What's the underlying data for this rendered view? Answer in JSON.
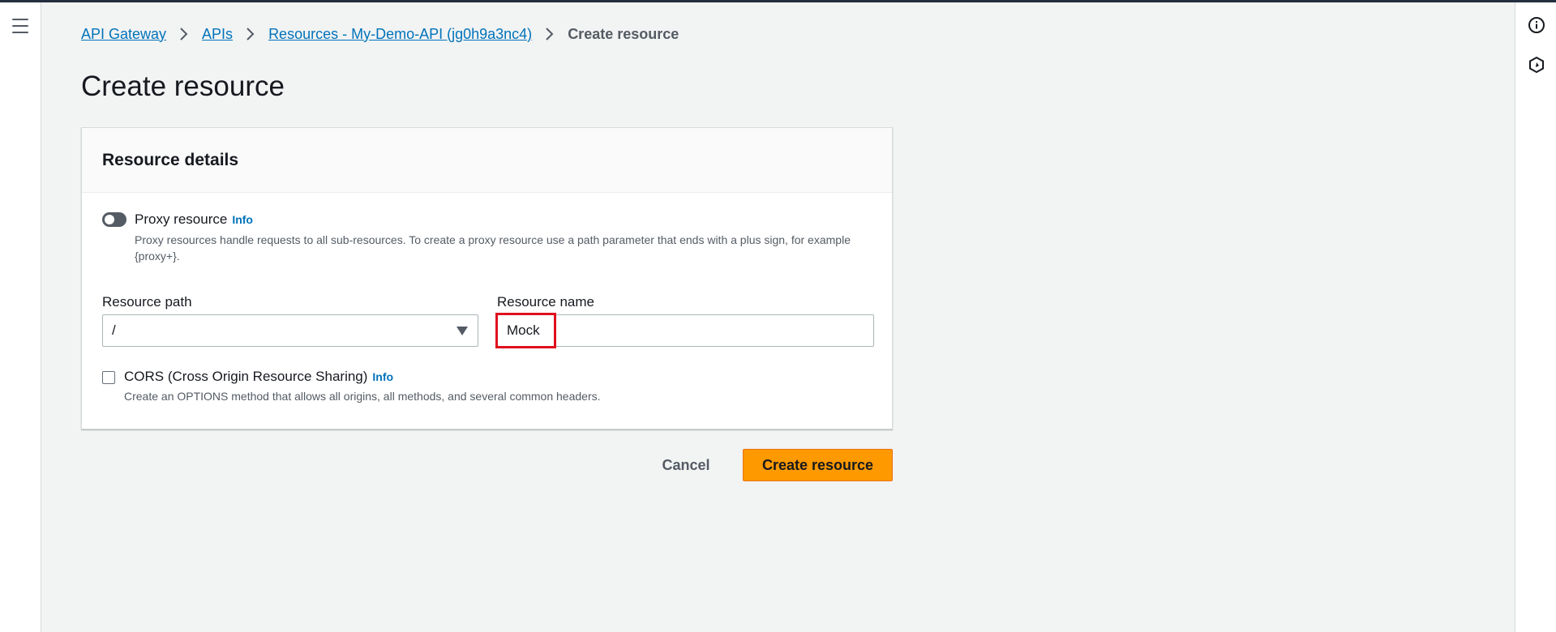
{
  "breadcrumb": {
    "items": [
      "API Gateway",
      "APIs",
      "Resources - My-Demo-API (jg0h9a3nc4)"
    ],
    "current": "Create resource"
  },
  "page": {
    "title": "Create resource"
  },
  "panel": {
    "title": "Resource details",
    "proxy": {
      "label": "Proxy resource",
      "info": "Info",
      "enabled": false,
      "description": "Proxy resources handle requests to all sub-resources. To create a proxy resource use a path parameter that ends with a plus sign, for example {proxy+}."
    },
    "resource_path": {
      "label": "Resource path",
      "value": "/"
    },
    "resource_name": {
      "label": "Resource name",
      "value": "Mock"
    },
    "cors": {
      "label": "CORS (Cross Origin Resource Sharing)",
      "info": "Info",
      "checked": false,
      "description": "Create an OPTIONS method that allows all origins, all methods, and several common headers."
    }
  },
  "actions": {
    "cancel": "Cancel",
    "create": "Create resource"
  },
  "icons": {
    "menu": "hamburger-menu-icon",
    "info": "info-circle-icon",
    "settings": "hexagon-settings-icon",
    "chevron": "chevron-right-icon",
    "caret": "caret-down-icon"
  },
  "colors": {
    "link": "#0073bb",
    "primary_button": "#ff9900",
    "highlight": "#e0101d"
  }
}
